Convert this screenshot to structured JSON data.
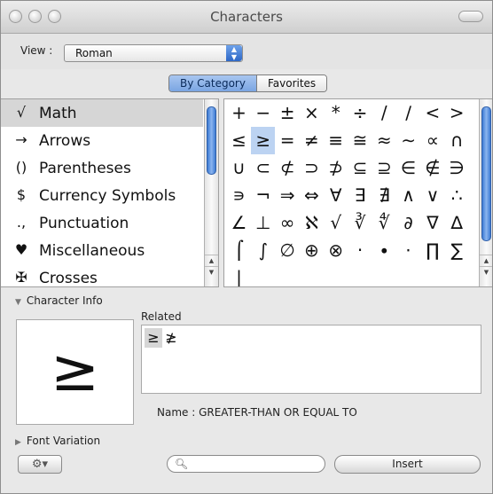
{
  "window": {
    "title": "Characters"
  },
  "view": {
    "label": "View :",
    "selected": "Roman"
  },
  "tabs": [
    {
      "label": "By Category",
      "active": true
    },
    {
      "label": "Favorites",
      "active": false
    }
  ],
  "categories": [
    {
      "icon": "√",
      "label": "Math",
      "selected": true
    },
    {
      "icon": "→",
      "label": "Arrows"
    },
    {
      "icon": "()",
      "label": "Parentheses"
    },
    {
      "icon": "$",
      "label": "Currency Symbols"
    },
    {
      "icon": ".,",
      "label": "Punctuation"
    },
    {
      "icon": "♥",
      "label": "Miscellaneous"
    },
    {
      "icon": "✠",
      "label": "Crosses"
    }
  ],
  "glyph_rows": [
    [
      "+",
      "−",
      "±",
      "×",
      "*",
      "÷",
      "/",
      "∕",
      "<",
      ">"
    ],
    [
      "≤",
      "≥",
      "=",
      "≠",
      "≡",
      "≅",
      "≈",
      "∼",
      "∝",
      "∩"
    ],
    [
      "∪",
      "⊂",
      "⊄",
      "⊃",
      "⊅",
      "⊆",
      "⊇",
      "∈",
      "∉",
      "∋"
    ],
    [
      "∍",
      "¬",
      "⇒",
      "⇔",
      "∀",
      "∃",
      "∄",
      "∧",
      "∨",
      "∴"
    ],
    [
      "∠",
      "⊥",
      "∞",
      "ℵ",
      "√",
      "∛",
      "∜",
      "∂",
      "∇",
      "∆"
    ],
    [
      "⌠",
      "∫",
      "∅",
      "⊕",
      "⊗",
      "·",
      "∙",
      "⋅",
      "∏",
      "∑"
    ],
    [
      "|",
      "",
      "",
      "",
      "",
      "",
      "",
      "",
      "",
      ""
    ],
    [
      "|",
      "",
      "",
      "",
      "",
      "",
      "",
      "",
      "",
      ""
    ]
  ],
  "selected_glyph": "≥",
  "info": {
    "header": "Character Info",
    "related_label": "Related",
    "related": [
      "≥",
      "≱"
    ],
    "name_text": "Name : GREATER-THAN OR EQUAL TO",
    "font_variation": "Font Variation"
  },
  "bottom": {
    "gear_icon": "⚙▾",
    "search_placeholder": "",
    "insert_label": "Insert"
  },
  "colors": {
    "selection": "#bcd3f2",
    "scroll_thumb": "#3d7bd4"
  }
}
